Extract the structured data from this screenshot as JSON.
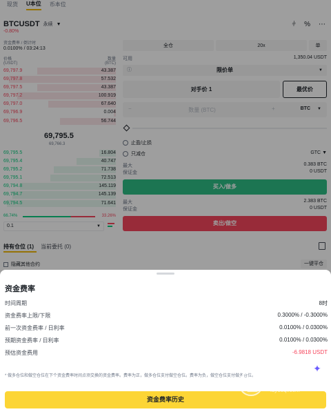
{
  "top_tabs": [
    "现货",
    "U本位",
    "币本位"
  ],
  "pair": {
    "name": "BTCUSDT",
    "type": "永续",
    "change": "-0.80%"
  },
  "funding": {
    "label": "资金费率 / 倒计时",
    "value": "0.0100% / 03:24:13"
  },
  "orderbook": {
    "price_label": "价格",
    "price_unit": "(USDT)",
    "qty_label": "数量",
    "qty_unit": "(BTC)",
    "asks": [
      {
        "price": "69,797.9",
        "qty": "43.387",
        "depth": 0.7
      },
      {
        "price": "69,797.8",
        "qty": "57.532",
        "depth": 0.95
      },
      {
        "price": "69,797.5",
        "qty": "43.387",
        "depth": 0.7
      },
      {
        "price": "69,797.2",
        "qty": "100.919",
        "depth": 0.88
      },
      {
        "price": "69,797.0",
        "qty": "67.640",
        "depth": 0.6
      },
      {
        "price": "69,796.9",
        "qty": "0.004",
        "depth": 0.02
      },
      {
        "price": "69,796.5",
        "qty": "56.744",
        "depth": 0.5
      }
    ],
    "mid_price": "69,795.5",
    "mark_price": "69,766.3",
    "bids": [
      {
        "price": "69,795.5",
        "qty": "16.804",
        "depth": 0.15
      },
      {
        "price": "69,795.4",
        "qty": "40.747",
        "depth": 0.35
      },
      {
        "price": "69,795.2",
        "qty": "71.738",
        "depth": 0.55
      },
      {
        "price": "69,795.1",
        "qty": "72.513",
        "depth": 0.58
      },
      {
        "price": "69,794.8",
        "qty": "145.119",
        "depth": 0.85
      },
      {
        "price": "69,794.7",
        "qty": "145.139",
        "depth": 0.92
      },
      {
        "price": "69,794.5",
        "qty": "71.641",
        "depth": 0.97
      }
    ],
    "buy_ratio": "66.74%",
    "sell_ratio": "33.26%",
    "depth_step": "0.1"
  },
  "form": {
    "margin_mode": "全仓",
    "leverage": "20x",
    "position_mode": "单",
    "available_label": "可用",
    "available_value": "1,350.04 USDT",
    "order_type": "限价单",
    "price_option": "对手价 1",
    "best_price": "最优价",
    "qty_placeholder": "数量 (BTC)",
    "qty_unit": "BTC",
    "tp_sl": "止盈/止损",
    "reduce_only": "只减仓",
    "tif": "GTC",
    "buy_max_label": "最大",
    "buy_max_value": "0.383 BTC",
    "buy_margin_label": "保证金",
    "buy_margin_value": "0 USDT",
    "buy_button": "买入/做多",
    "sell_max_label": "最大",
    "sell_max_value": "2.383 BTC",
    "sell_margin_label": "保证金",
    "sell_margin_value": "0 USDT",
    "sell_button": "卖出/做空"
  },
  "positions": {
    "tab_positions": "持有仓位 (1)",
    "tab_orders": "当前委托 (0)",
    "hide_others": "隐藏其他合约",
    "close_all": "一键平仓"
  },
  "sheet": {
    "title": "资金费率",
    "rows": [
      {
        "label": "时间周期",
        "value": "8时"
      },
      {
        "label": "资金费率上限/下限",
        "value": "0.3000% / -0.3000%"
      },
      {
        "label": "前一次资金费率 / 日利率",
        "value": "0.0100% / 0.0300%"
      },
      {
        "label": "预期资金费率 / 日利率",
        "value": "0.0100% / 0.0300%"
      },
      {
        "label": "预估资金费用",
        "value": "-6.9818 USDT"
      }
    ],
    "footnote": "* 做多仓位和做空仓位在下个资金费率时间点须交换的资金费率。费率为正，做多仓位支付做空仓位。费率为负，做空仓位支付做多仓位。",
    "history_button": "资金费率历史"
  },
  "watermark": {
    "title": "路由器",
    "url": "luyouqi.com"
  }
}
